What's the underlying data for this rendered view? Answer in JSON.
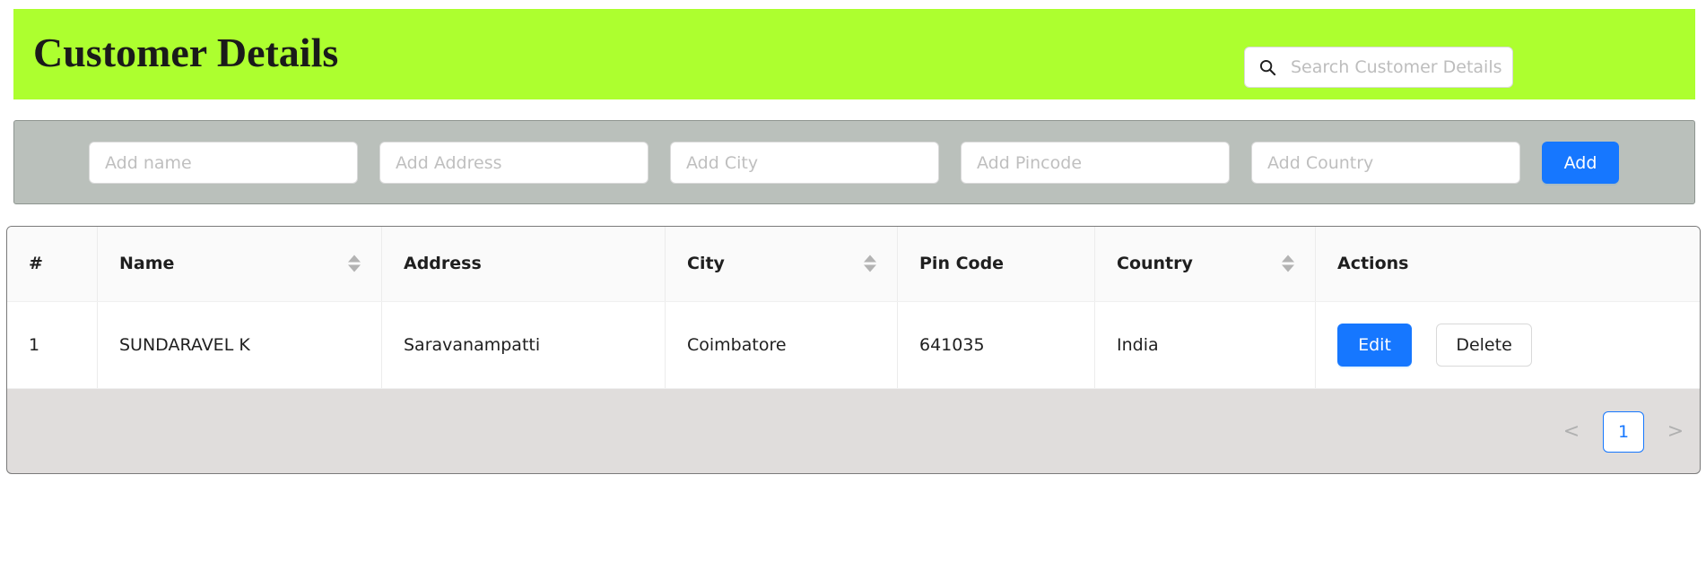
{
  "header": {
    "title": "Customer Details",
    "search_placeholder": "Search Customer Details"
  },
  "form": {
    "name_placeholder": "Add name",
    "address_placeholder": "Add Address",
    "city_placeholder": "Add City",
    "pincode_placeholder": "Add Pincode",
    "country_placeholder": "Add Country",
    "add_label": "Add"
  },
  "table": {
    "columns": [
      "#",
      "Name",
      "Address",
      "City",
      "Pin Code",
      "Country",
      "Actions"
    ],
    "rows": [
      {
        "index": "1",
        "name": "SUNDARAVEL K",
        "address": "Saravanampatti",
        "city": "Coimbatore",
        "pincode": "641035",
        "country": "India",
        "edit_label": "Edit",
        "delete_label": "Delete"
      }
    ]
  },
  "pagination": {
    "prev": "<",
    "current_page": "1",
    "next": ">"
  },
  "colors": {
    "header_bg": "#adff2f",
    "form_bg": "#bac0bb",
    "primary": "#1677ff",
    "footer_bg": "#e0dddc"
  },
  "icons": [
    "search-icon",
    "sort-icon",
    "chevron-left-icon",
    "chevron-right-icon"
  ]
}
